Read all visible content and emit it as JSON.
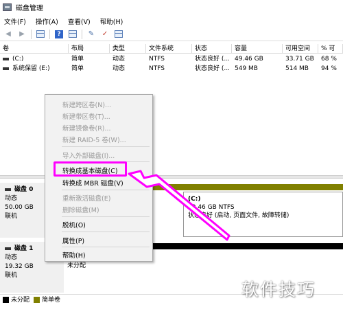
{
  "window": {
    "title": "磁盘管理"
  },
  "menu": [
    "文件(F)",
    "操作(A)",
    "查看(V)",
    "帮助(H)"
  ],
  "volume_table": {
    "headers": [
      "卷",
      "布局",
      "类型",
      "文件系统",
      "状态",
      "容量",
      "可用空间",
      "% 可"
    ],
    "rows": [
      {
        "name": "(C:)",
        "layout": "简单",
        "type": "动态",
        "fs": "NTFS",
        "status": "状态良好 (...",
        "capacity": "49.46 GB",
        "free": "33.71 GB",
        "pct": "68 %"
      },
      {
        "name": "系统保留 (E:)",
        "layout": "简单",
        "type": "动态",
        "fs": "NTFS",
        "status": "状态良好 (...",
        "capacity": "549 MB",
        "free": "514 MB",
        "pct": "94 %"
      }
    ]
  },
  "context_menu": {
    "items": [
      {
        "label": "新建跨区卷(N)...",
        "enabled": false
      },
      {
        "label": "新建带区卷(T)...",
        "enabled": false
      },
      {
        "label": "新建镜像卷(R)...",
        "enabled": false
      },
      {
        "label": "新建 RAID-5 卷(W)...",
        "enabled": false
      },
      {
        "label": "导入外部磁盘(I)...",
        "enabled": false
      },
      {
        "label": "转换成基本磁盘(C)",
        "enabled": true,
        "highlighted": true
      },
      {
        "label": "转换成 MBR 磁盘(V)",
        "enabled": true
      },
      {
        "label": "重新激活磁盘(E)",
        "enabled": false
      },
      {
        "label": "删除磁盘(M)",
        "enabled": false
      },
      {
        "label": "脱机(O)",
        "enabled": true
      },
      {
        "label": "属性(P)",
        "enabled": true
      },
      {
        "label": "帮助(H)",
        "enabled": true
      }
    ]
  },
  "disks": [
    {
      "name": "磁盘 0",
      "type": "动态",
      "size": "50.00 GB",
      "status": "联机",
      "partition": {
        "title": "(C:)",
        "size_fs": "49.46 GB NTFS",
        "status": "状态良好 (启动, 页面文件, 故障转储)"
      }
    },
    {
      "name": "磁盘 1",
      "type": "动态",
      "size": "19.32 GB",
      "status": "联机",
      "partition": {
        "size": "19.32 GB",
        "status": "未分配"
      }
    }
  ],
  "legend": [
    {
      "label": "未分配",
      "color": "#000000"
    },
    {
      "label": "简单卷",
      "color": "#808000"
    }
  ],
  "watermark": "软件技巧",
  "colors": {
    "highlight": "#ff00ff",
    "simple_volume": "#808000",
    "unallocated": "#000000"
  }
}
